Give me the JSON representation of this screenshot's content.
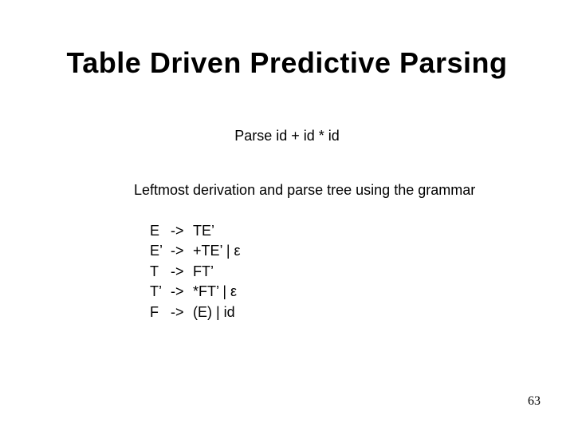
{
  "title": "Table Driven Predictive Parsing",
  "parse_line": "Parse id + id * id",
  "derivation_line": "Leftmost derivation and parse tree using the grammar",
  "grammar": {
    "arrow": "->",
    "rules": [
      {
        "lhs": "E",
        "rhs": "TE’"
      },
      {
        "lhs": "E’",
        "rhs": "+TE’ | ε"
      },
      {
        "lhs": "T",
        "rhs": "FT’"
      },
      {
        "lhs": "T’",
        "rhs": "*FT’ | ε"
      },
      {
        "lhs": "F",
        "rhs": "(E) | id"
      }
    ]
  },
  "page_number": "63"
}
